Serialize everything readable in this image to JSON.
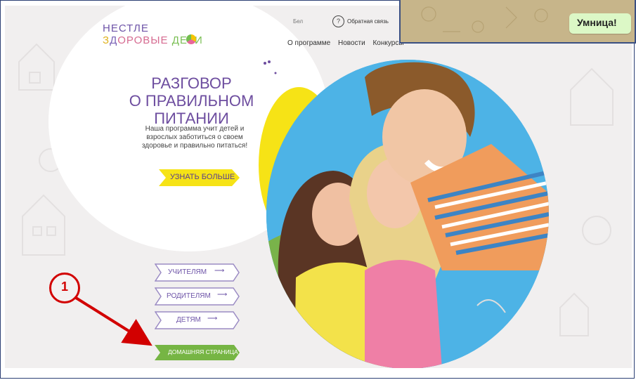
{
  "site": {
    "logo": {
      "line1": "НЕСТЛЕ",
      "line2_parts": [
        "З",
        "Д",
        "ОРОВЫЕ",
        " ",
        "ДЕТИ"
      ]
    },
    "header": {
      "lang": "Бел",
      "feedback_icon": "?",
      "feedback": "Обратная связь",
      "nav": [
        "О программе",
        "Новости",
        "Конкурсы"
      ]
    },
    "hero": {
      "headline_1": "РАЗГОВОР",
      "headline_2": "О ПРАВИЛЬНОМ ПИТАНИИ",
      "description": "Наша программа учит детей и взрослых заботиться о своем здоровье и правильно питаться!",
      "more_button": "УЗНАТЬ БОЛЬШЕ"
    },
    "audience": [
      {
        "label": "УЧИТЕЛЯМ",
        "arrow": "⟶"
      },
      {
        "label": "РОДИТЕЛЯМ",
        "arrow": "⟶"
      },
      {
        "label": "ДЕТЯМ",
        "arrow": "⟶"
      }
    ],
    "home_button": "ДОМАШНЯЯ СТРАНИЦА"
  },
  "overlay": {
    "chat_message": "Умница!"
  },
  "annotation": {
    "callout_number": "1"
  },
  "colors": {
    "purple": "#6d4d9f",
    "yellow": "#f6e316",
    "green": "#76b544",
    "red": "#d20000"
  }
}
